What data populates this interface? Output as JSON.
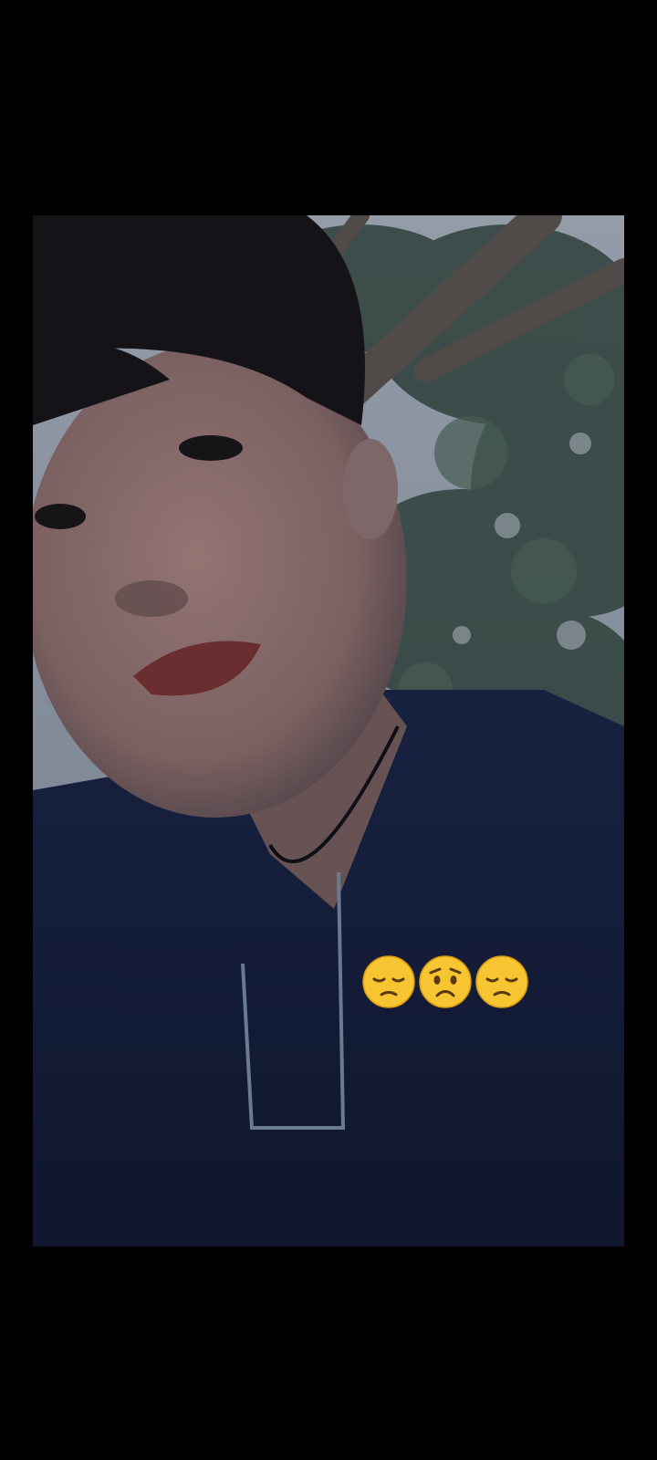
{
  "story": {
    "photo_description_icon": "selfie-photo",
    "sticker_emojis": [
      {
        "icon": "pensive-face-emoji",
        "char": "😔"
      },
      {
        "icon": "worried-face-emoji",
        "char": "😟"
      },
      {
        "icon": "pensive-face-emoji",
        "char": "😔"
      }
    ]
  },
  "colors": {
    "background": "#000000",
    "shirt": "#17213f",
    "sky": "#dfe7ef",
    "foliage": "#3f5a46",
    "skin": "#b98c82",
    "hair": "#1a1614",
    "emoji_yellow": "#f7c531"
  }
}
